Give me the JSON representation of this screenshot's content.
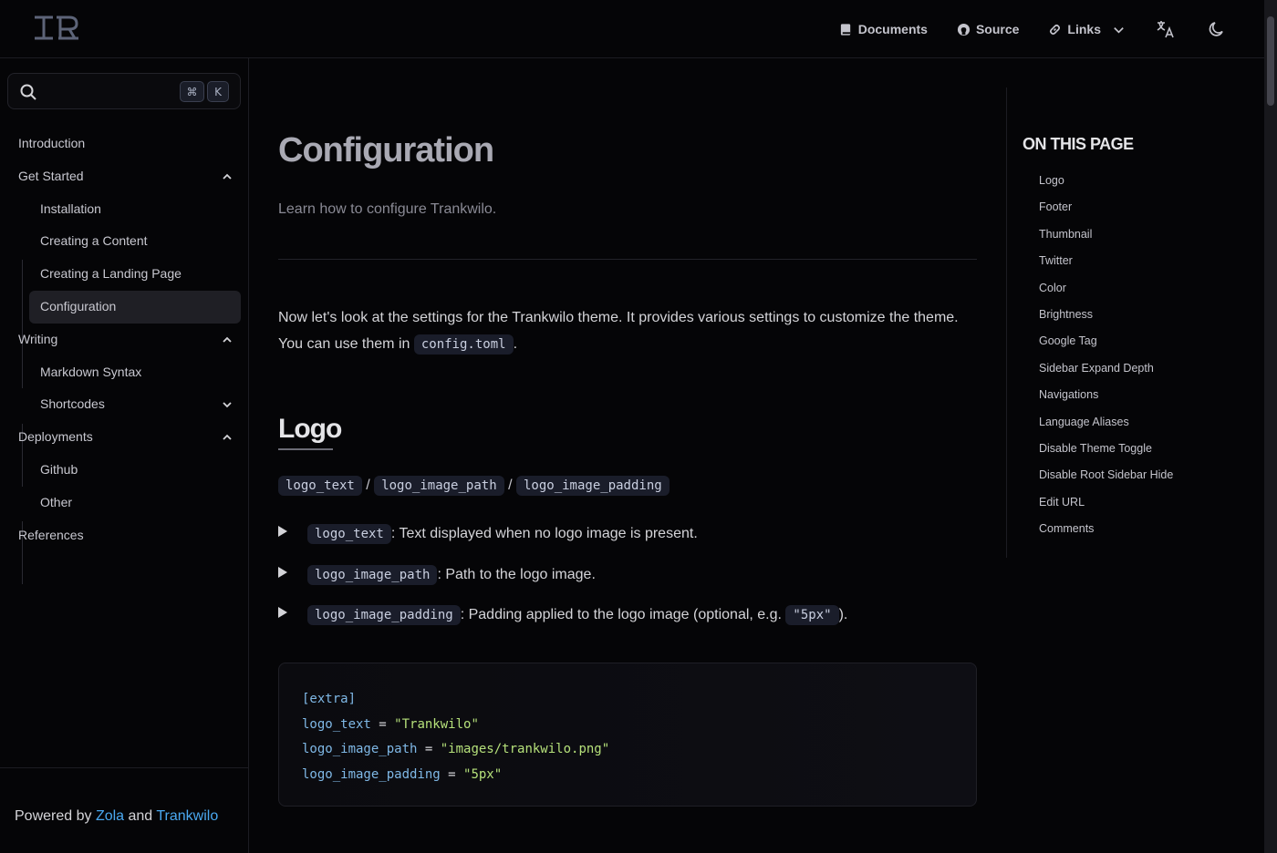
{
  "header": {
    "nav": {
      "documents": "Documents",
      "source": "Source",
      "links": "Links"
    }
  },
  "search": {
    "kbd_cmd": "⌘",
    "kbd_k": "K"
  },
  "sidebar": {
    "items": [
      {
        "label": "Introduction"
      },
      {
        "label": "Get Started"
      },
      {
        "label": "Installation"
      },
      {
        "label": "Creating a Content"
      },
      {
        "label": "Creating a Landing Page"
      },
      {
        "label": "Configuration"
      },
      {
        "label": "Writing"
      },
      {
        "label": "Markdown Syntax"
      },
      {
        "label": "Shortcodes"
      },
      {
        "label": "Deployments"
      },
      {
        "label": "Github"
      },
      {
        "label": "Other"
      },
      {
        "label": "References"
      }
    ],
    "footer": {
      "prefix": "Powered by ",
      "zola": "Zola",
      "and": " and ",
      "trankwilo": "Trankwilo"
    }
  },
  "main": {
    "title": "Configuration",
    "description": "Learn how to configure Trankwilo.",
    "intro_text": "Now let's look at the settings for the Trankwilo theme. It provides various settings to customize the theme. You can use them in ",
    "intro_code": "config.toml",
    "intro_end": ".",
    "section_logo": {
      "heading": "Logo",
      "code_names": [
        "logo_text",
        "logo_image_path",
        "logo_image_padding"
      ],
      "separator": " / ",
      "bullets": [
        {
          "code": "logo_text",
          "text": ": Text displayed when no logo image is present."
        },
        {
          "code": "logo_image_path",
          "text": ": Path to the logo image."
        },
        {
          "code": "logo_image_padding",
          "text": ": Padding applied to the logo image (optional, e.g. ",
          "code2": "\"5px\"",
          "text2": ")."
        }
      ],
      "codeblock": {
        "line1": "[extra]",
        "line2_key": "logo_text",
        "line2_val": "\"Trankwilo\"",
        "line3_key": "logo_image_path",
        "line3_val": "\"images/trankwilo.png\"",
        "line4_key": "logo_image_padding",
        "line4_val": "\"5px\"",
        "eq": " = "
      }
    }
  },
  "toc": {
    "title": "ON THIS PAGE",
    "items": [
      "Logo",
      "Footer",
      "Thumbnail",
      "Twitter",
      "Color",
      "Brightness",
      "Google Tag",
      "Sidebar Expand Depth",
      "Navigations",
      "Language Aliases",
      "Disable Theme Toggle",
      "Disable Root Sidebar Hide",
      "Edit URL",
      "Comments"
    ]
  },
  "colors": {
    "background": "#050507",
    "link": "#4aa8f0",
    "code_key": "#7fb8e6",
    "code_string": "#b5e07a"
  }
}
